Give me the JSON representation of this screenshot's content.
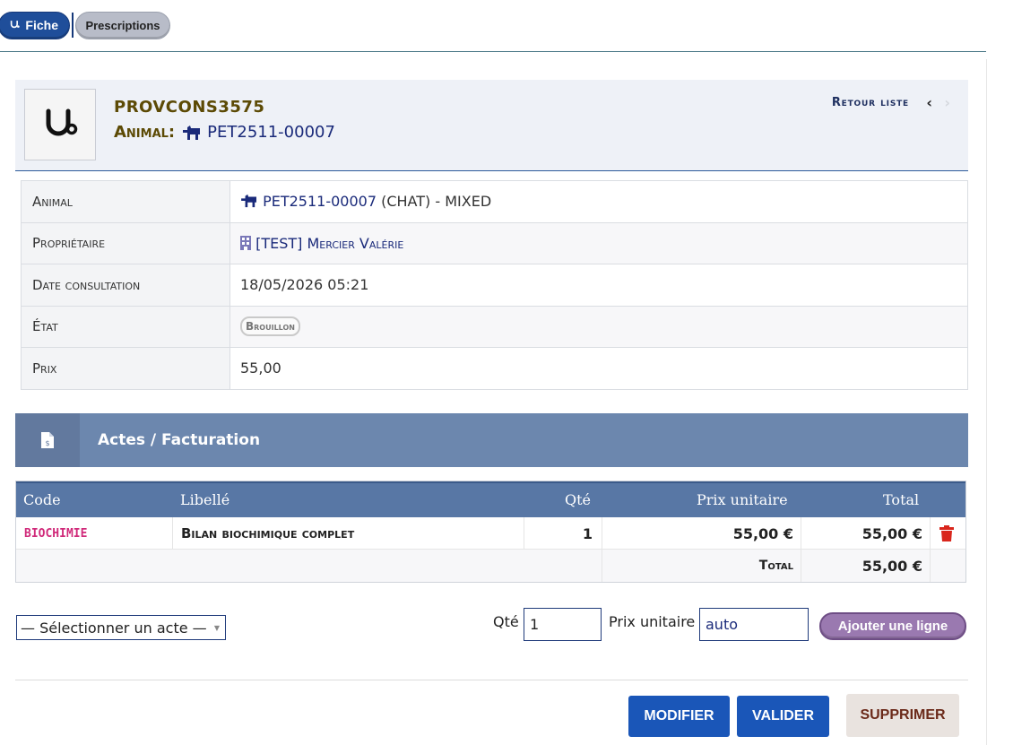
{
  "tabs": {
    "fiche": "Fiche",
    "prescriptions": "Prescriptions"
  },
  "header": {
    "title": "PROVCONS3575",
    "animal_label": "Animal:",
    "animal_value": "PET2511-00007",
    "retour": "Retour liste",
    "prev": "‹",
    "next": "›"
  },
  "info": {
    "animal_label": "Animal",
    "animal_id": "PET2511-00007",
    "animal_rest": "(CHAT) - MIXED",
    "proprietaire_label": "Propriétaire",
    "proprietaire_value": "[TEST] Mercier Valérie",
    "date_label": "Date consultation",
    "date_value": "18/05/2026 05:21",
    "etat_label": "État",
    "etat_value": "Brouillon",
    "prix_label": "Prix",
    "prix_value": "55,00"
  },
  "section": {
    "title": "Actes / Facturation"
  },
  "lines": {
    "columns": [
      "Code",
      "Libellé",
      "Qté",
      "Prix unitaire",
      "Total"
    ],
    "rows": [
      {
        "code": "BIOCHIMIE",
        "libelle": "Bilan biochimique complet",
        "qte": "1",
        "pu": "55,00 €",
        "total": "55,00 €"
      }
    ],
    "total_label": "Total",
    "total_value": "55,00 €"
  },
  "form": {
    "select_placeholder": "— Sélectionner un acte —",
    "qte_label": "Qté",
    "qte_value": "1",
    "pu_label": "Prix unitaire",
    "pu_value": "auto",
    "add_button": "Ajouter une ligne"
  },
  "actions": {
    "modifier": "MODIFIER",
    "valider": "VALIDER",
    "supprimer": "SUPPRIMER"
  },
  "colors": {
    "primary": "#1a56b8",
    "section": "#6c87ae",
    "code": "#d02a7a",
    "delete": "#d9261c"
  }
}
